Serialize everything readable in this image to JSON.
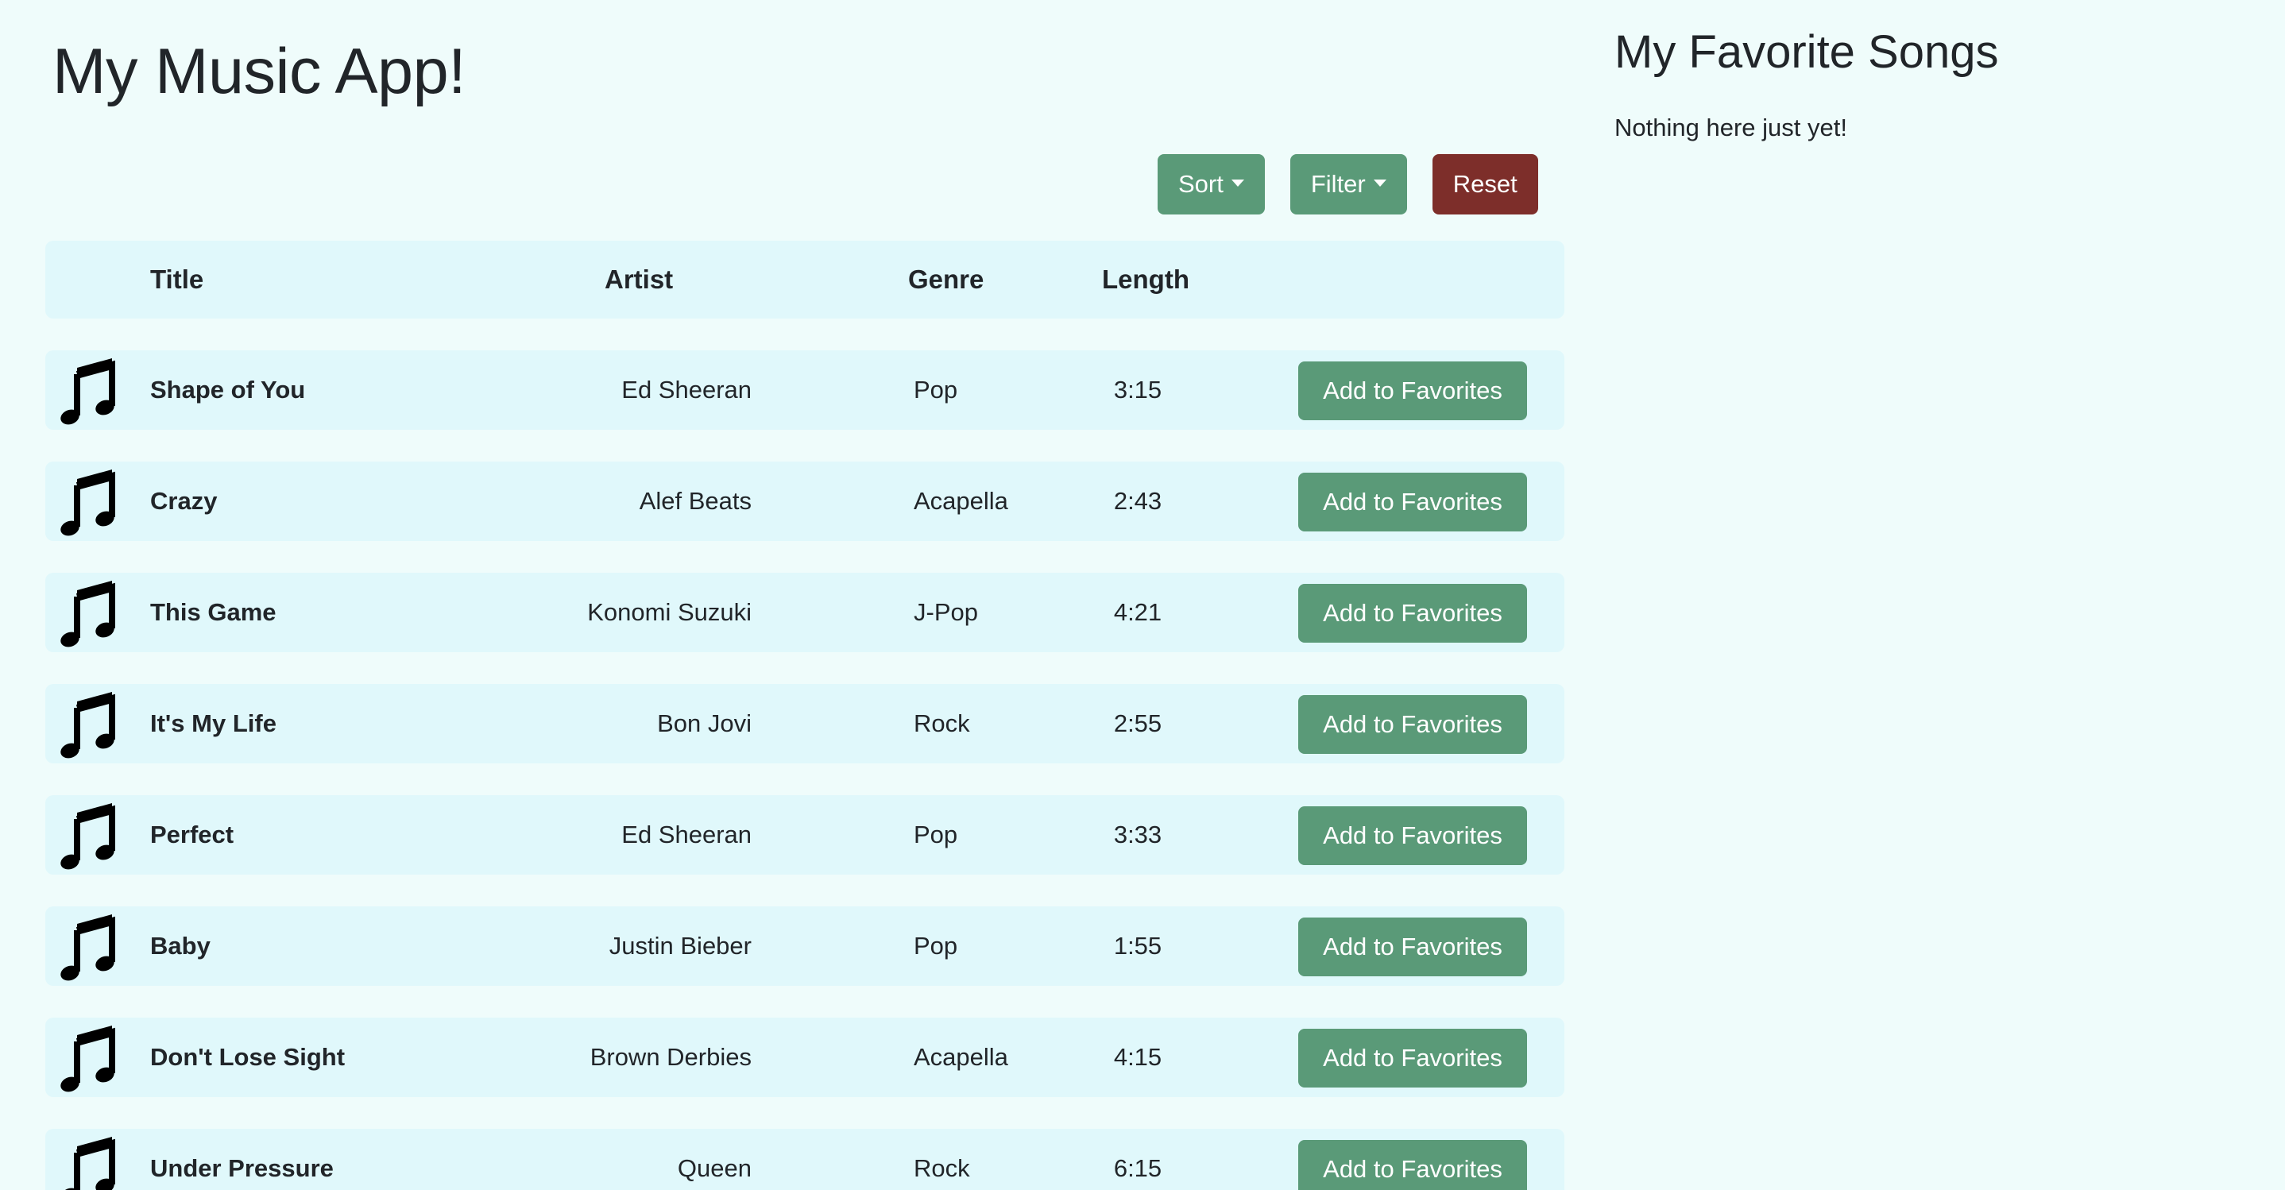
{
  "app": {
    "title": "My Music App!"
  },
  "toolbar": {
    "sort_label": "Sort",
    "filter_label": "Filter",
    "reset_label": "Reset"
  },
  "table": {
    "headers": {
      "title": "Title",
      "artist": "Artist",
      "genre": "Genre",
      "length": "Length"
    },
    "rows": [
      {
        "title": "Shape of You",
        "artist": "Ed Sheeran",
        "genre": "Pop",
        "length": "3:15",
        "action": "Add to Favorites"
      },
      {
        "title": "Crazy",
        "artist": "Alef Beats",
        "genre": "Acapella",
        "length": "2:43",
        "action": "Add to Favorites"
      },
      {
        "title": "This Game",
        "artist": "Konomi Suzuki",
        "genre": "J-Pop",
        "length": "4:21",
        "action": "Add to Favorites"
      },
      {
        "title": "It's My Life",
        "artist": "Bon Jovi",
        "genre": "Rock",
        "length": "2:55",
        "action": "Add to Favorites"
      },
      {
        "title": "Perfect",
        "artist": "Ed Sheeran",
        "genre": "Pop",
        "length": "3:33",
        "action": "Add to Favorites"
      },
      {
        "title": "Baby",
        "artist": "Justin Bieber",
        "genre": "Pop",
        "length": "1:55",
        "action": "Add to Favorites"
      },
      {
        "title": "Don't Lose Sight",
        "artist": "Brown Derbies",
        "genre": "Acapella",
        "length": "4:15",
        "action": "Add to Favorites"
      },
      {
        "title": "Under Pressure",
        "artist": "Queen",
        "genre": "Rock",
        "length": "6:15",
        "action": "Add to Favorites"
      }
    ],
    "row_icon": "music-note-icon"
  },
  "sidebar": {
    "title": "My Favorite Songs",
    "empty_message": "Nothing here just yet!"
  },
  "colors": {
    "background": "#effcfb",
    "row_background": "#e0f8fb",
    "primary_button": "#5a9a78",
    "danger_button": "#7d2e2a"
  }
}
